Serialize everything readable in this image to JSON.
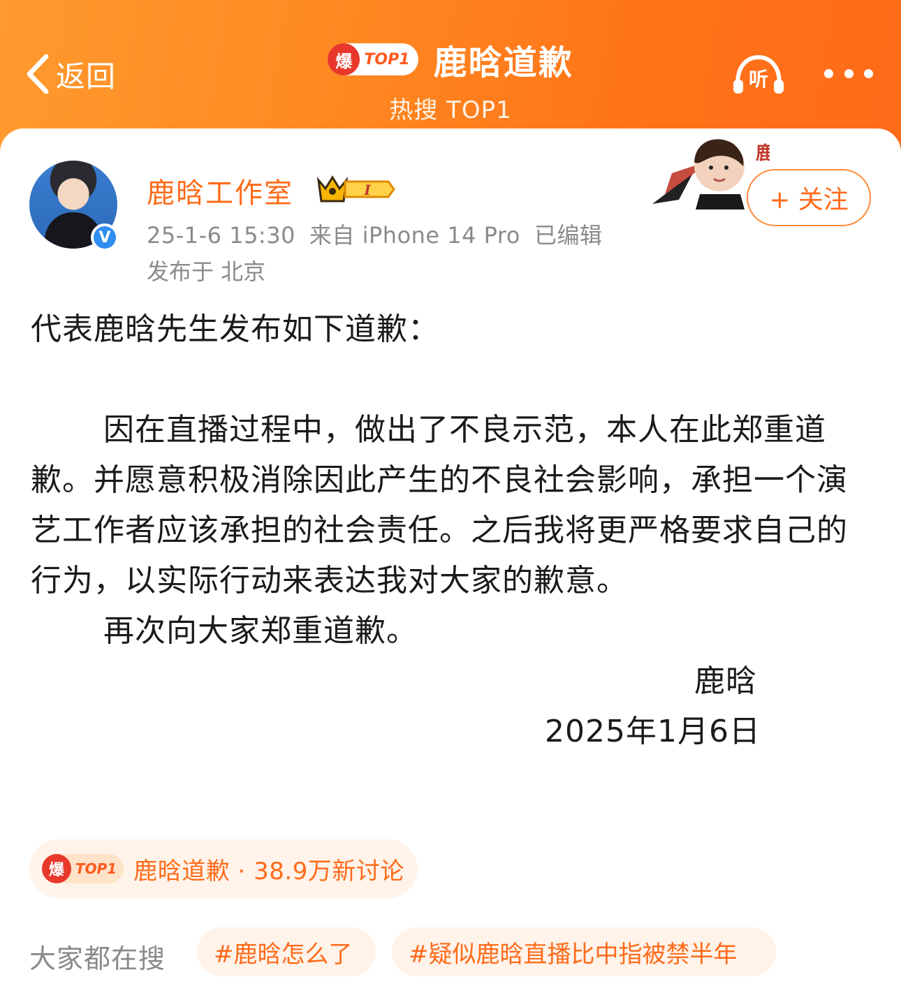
{
  "header": {
    "back_label": "返回",
    "badge_hot": "爆",
    "badge_rank": "TOP1",
    "title": "鹿晗道歉",
    "subtitle": "热搜 TOP1",
    "listen_label": "听"
  },
  "post": {
    "author": "鹿晗工作室",
    "level_badge": "I",
    "verified_mark": "V",
    "time": "25-1-6 15:30",
    "source": "来自 iPhone 14 Pro",
    "edited": "已编辑",
    "location": "发布于 北京",
    "follow_label": "+ 关注",
    "deco_art_text": "鹿",
    "intro": "代表鹿晗先生发布如下道歉：",
    "body": "因在直播过程中，做出了不良示范，本人在此郑重道歉。并愿意积极消除因此产生的不良社会影响，承担一个演艺工作者应该承担的社会责任。之后我将更严格要求自己的行为，以实际行动来表达我对大家的歉意。",
    "closing": "再次向大家郑重道歉。",
    "signature": "鹿晗",
    "date": "2025年1月6日"
  },
  "topic": {
    "badge_hot": "爆",
    "badge_rank": "TOP1",
    "text": "鹿晗道歉 · 38.9万新讨论"
  },
  "related": {
    "label": "大家都在搜",
    "tags": [
      "#鹿晗怎么了",
      "#疑似鹿晗直播比中指被禁半年"
    ]
  },
  "colors": {
    "accent": "#ff6b1a",
    "header_bg": "#ff8a22",
    "pill_bg": "#fff3ea",
    "verified": "#2f8ef0"
  }
}
